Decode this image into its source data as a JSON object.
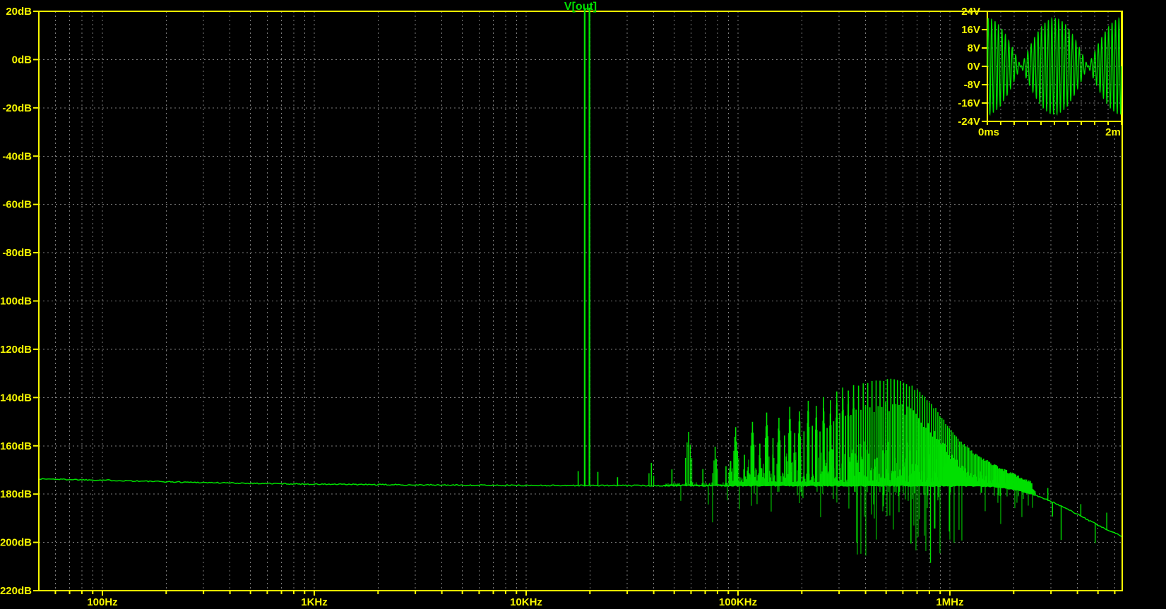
{
  "window": {
    "background_color": "#000000",
    "axis_color": "#f8f800",
    "grid_color": "#7d7d7d",
    "trace_color": "#00e000",
    "title_color": "#00e000"
  },
  "chart_data": {
    "type": "line",
    "title": "V[out]",
    "description": "FFT magnitude spectrum of V(out): 19kHz+20kHz two-tone signal, noise floor ~-176dB, shaped-noise spur hump peaking ~-133dB near 520kHz, roll-off to ~-198dB at 6.5MHz",
    "x_axis": {
      "scale": "log",
      "unit": "Hz",
      "tick_labels": [
        "100Hz",
        "1KHz",
        "10KHz",
        "100KHz",
        "1MHz"
      ],
      "tick_freqs_hz": [
        100,
        1000,
        10000,
        100000,
        1000000
      ],
      "range_hz": [
        50,
        6500000
      ],
      "grid": "dashed, minor lines at 2-9 per decade"
    },
    "y_axis": {
      "unit": "dB",
      "tick_labels": [
        "20dB",
        "0dB",
        "-20dB",
        "-40dB",
        "-60dB",
        "-80dB",
        "-100dB",
        "-120dB",
        "-140dB",
        "-160dB",
        "-180dB",
        "-200dB",
        "-220dB"
      ],
      "tick_values_db": [
        20,
        0,
        -20,
        -40,
        -60,
        -80,
        -100,
        -120,
        -140,
        -160,
        -180,
        -200,
        -220
      ],
      "range_db": [
        -220,
        20
      ],
      "grid": "dashed horizontal at each 20dB"
    },
    "tones_hz_db": [
      [
        18900,
        21.5
      ],
      [
        19900,
        21.5
      ]
    ],
    "near_tone_spurs_hz_db": [
      [
        17600,
        -170.5
      ],
      [
        21800,
        -170.8
      ],
      [
        27000,
        -173.0
      ]
    ],
    "noise_floor_anchors_hz_db": [
      [
        50,
        -173.7
      ],
      [
        100,
        -174.2
      ],
      [
        200,
        -174.9
      ],
      [
        400,
        -175.4
      ],
      [
        700,
        -175.7
      ],
      [
        1000,
        -175.9
      ],
      [
        2000,
        -176.1
      ],
      [
        5000,
        -176.3
      ],
      [
        10000,
        -176.4
      ],
      [
        50000,
        -176.5
      ],
      [
        200000,
        -176.5
      ],
      [
        700000,
        -176.5
      ],
      [
        1200000,
        -176.6
      ],
      [
        1600000,
        -176.9
      ],
      [
        2000000,
        -177.9
      ],
      [
        2500000,
        -180.2
      ],
      [
        3000000,
        -183.0
      ],
      [
        3500000,
        -185.8
      ],
      [
        4000000,
        -188.4
      ],
      [
        4500000,
        -190.8
      ],
      [
        5000000,
        -192.9
      ],
      [
        5500000,
        -194.7
      ],
      [
        6000000,
        -196.2
      ],
      [
        6500000,
        -197.6
      ]
    ],
    "spur_spacing_hz": 9750,
    "spur_envelope_anchors_hz_db": [
      [
        39000,
        -167.0
      ],
      [
        58500,
        -154.5
      ],
      [
        78000,
        -160.5
      ],
      [
        97500,
        -152.0
      ],
      [
        117000,
        -150.0
      ],
      [
        136500,
        -146.0
      ],
      [
        156000,
        -148.5
      ],
      [
        175500,
        -143.5
      ],
      [
        195000,
        -145.5
      ],
      [
        214500,
        -141.5
      ],
      [
        234000,
        -143.0
      ],
      [
        253500,
        -139.5
      ],
      [
        273000,
        -141.0
      ],
      [
        292500,
        -137.8
      ],
      [
        312000,
        -136.0
      ],
      [
        331500,
        -137.3
      ],
      [
        351000,
        -134.8
      ],
      [
        370500,
        -135.6
      ],
      [
        390000,
        -134.0
      ],
      [
        429000,
        -133.4
      ],
      [
        468000,
        -132.9
      ],
      [
        507000,
        -132.6
      ],
      [
        546000,
        -132.8
      ],
      [
        585000,
        -133.4
      ],
      [
        624000,
        -134.4
      ],
      [
        663000,
        -135.6
      ],
      [
        702000,
        -137.2
      ],
      [
        741000,
        -138.9
      ],
      [
        780000,
        -140.8
      ],
      [
        819000,
        -142.8
      ],
      [
        858000,
        -144.9
      ],
      [
        897000,
        -147.1
      ],
      [
        936000,
        -149.3
      ],
      [
        975000,
        -151.5
      ],
      [
        1053000,
        -155.4
      ],
      [
        1150000,
        -159.0
      ],
      [
        1300000,
        -163.0
      ],
      [
        1500000,
        -166.5
      ],
      [
        1700000,
        -169.0
      ],
      [
        1950000,
        -171.5
      ],
      [
        2200000,
        -173.5
      ],
      [
        2450000,
        -175.5
      ]
    ],
    "deep_notches_hz_db": [
      [
        655000,
        -200.5
      ],
      [
        810000,
        -208.5
      ]
    ],
    "tail_spurs_hz_delta_db": [
      [
        2900000,
        5
      ],
      [
        3050000,
        -6
      ],
      [
        3350000,
        -14
      ],
      [
        4150000,
        5
      ],
      [
        4850000,
        -8
      ],
      [
        5500000,
        7
      ]
    ],
    "inset": {
      "type": "line",
      "description": "time-domain two-tone (19kHz + 20kHz) beat waveform, envelope nulls at 0.5ms and 1.5ms",
      "tone1_hz": 19000,
      "tone2_hz": 20000,
      "amplitude_each_v": 10.5,
      "t_start_ms": 0,
      "t_end_ms": 2,
      "ylim_v": [
        -24,
        24
      ],
      "y_tick_labels": [
        "24V",
        "16V",
        "8V",
        "0V",
        "-8V",
        "-16V",
        "-24V"
      ],
      "y_tick_values_v": [
        24,
        16,
        8,
        0,
        -8,
        -16,
        -24
      ],
      "x_labels": [
        "0ms",
        "2m"
      ],
      "x_grid_step_ms": 0.2
    }
  }
}
